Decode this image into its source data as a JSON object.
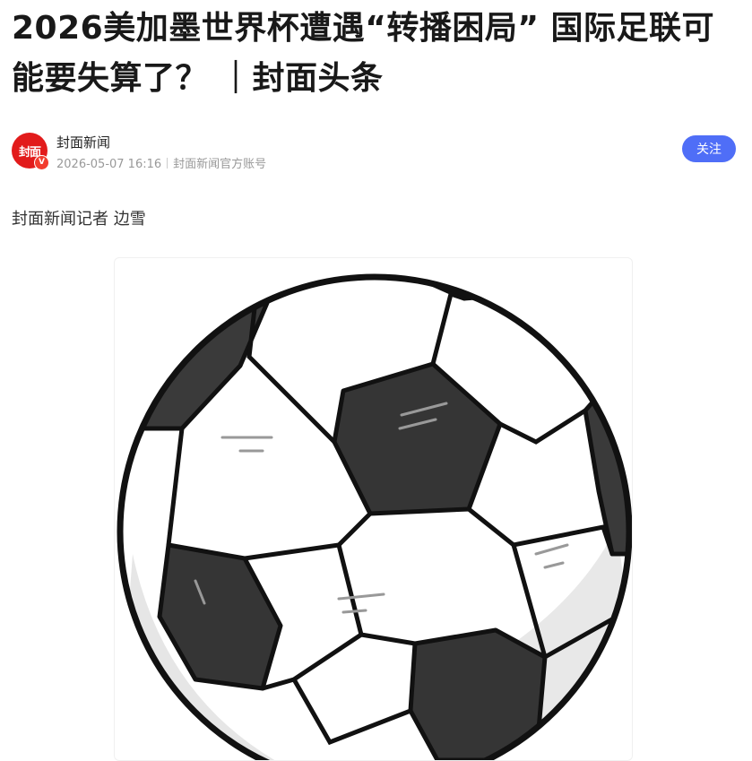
{
  "article": {
    "title": "2026美加墨世界杯遭遇“转播困局” 国际足联可能要失算了？ ｜封面头条",
    "byline": "封面新闻记者 边雪"
  },
  "author": {
    "name": "封面新闻",
    "avatar_text": "封面",
    "verified_mark": "V",
    "date": "2026-05-07 16:16",
    "account_type": "封面新闻官方账号",
    "follow_label": "关注"
  },
  "image": {
    "icon": "soccer-ball-icon"
  },
  "colors": {
    "brand_red": "#e21b1b",
    "follow_blue": "#4f6ef7"
  }
}
